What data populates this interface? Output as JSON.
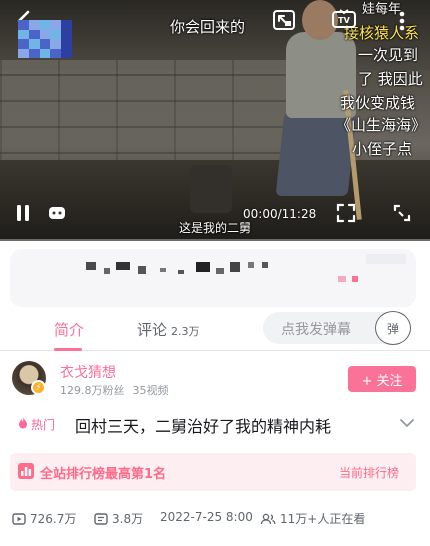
{
  "player": {
    "current_time": "00:00",
    "duration": "11:28",
    "time_separator": "/",
    "subtitle": "这是我的二舅",
    "progress": 0.0,
    "danmaku": [
      {
        "text": "你会回来的",
        "color": "#ffffff"
      },
      {
        "text": "接核猿人系",
        "color": "#ffe44c"
      },
      {
        "text": "一次见到",
        "color": "#ffffff"
      },
      {
        "text": "了 我因此",
        "color": "#ffffff"
      },
      {
        "text": "我伙变成钱",
        "color": "#ffffff"
      },
      {
        "text": "《山生海海》",
        "color": "#ffffff"
      },
      {
        "text": "小侄子点",
        "color": "#ffffff"
      },
      {
        "text": "娃每年",
        "color": "#ffffff"
      }
    ]
  },
  "tabs": [
    {
      "label": "简介",
      "active": true
    },
    {
      "label": "评论",
      "count": "2.3万",
      "active": false
    }
  ],
  "danmaku_input": {
    "placeholder": "点我发弹幕",
    "toggle_label": "弹"
  },
  "uploader": {
    "name": "衣戈猜想",
    "fans": "129.8万粉丝",
    "videos": "35视频",
    "follow_label": "+ 关注"
  },
  "video": {
    "hot_tag": "热门",
    "title": "回村三天，二舅治好了我的精神内耗"
  },
  "ranking": {
    "text": "全站排行榜最高第1名",
    "link": "当前排行榜"
  },
  "stats": {
    "views": "726.7万",
    "danmaku_count": "3.8万",
    "publish_time": "2022-7-25 8:00",
    "watching": "11万+人正在看"
  },
  "colors": {
    "accent": "#fb7299",
    "rank_bg": "#fdeef1",
    "rank_text": "#ff6b8a"
  }
}
